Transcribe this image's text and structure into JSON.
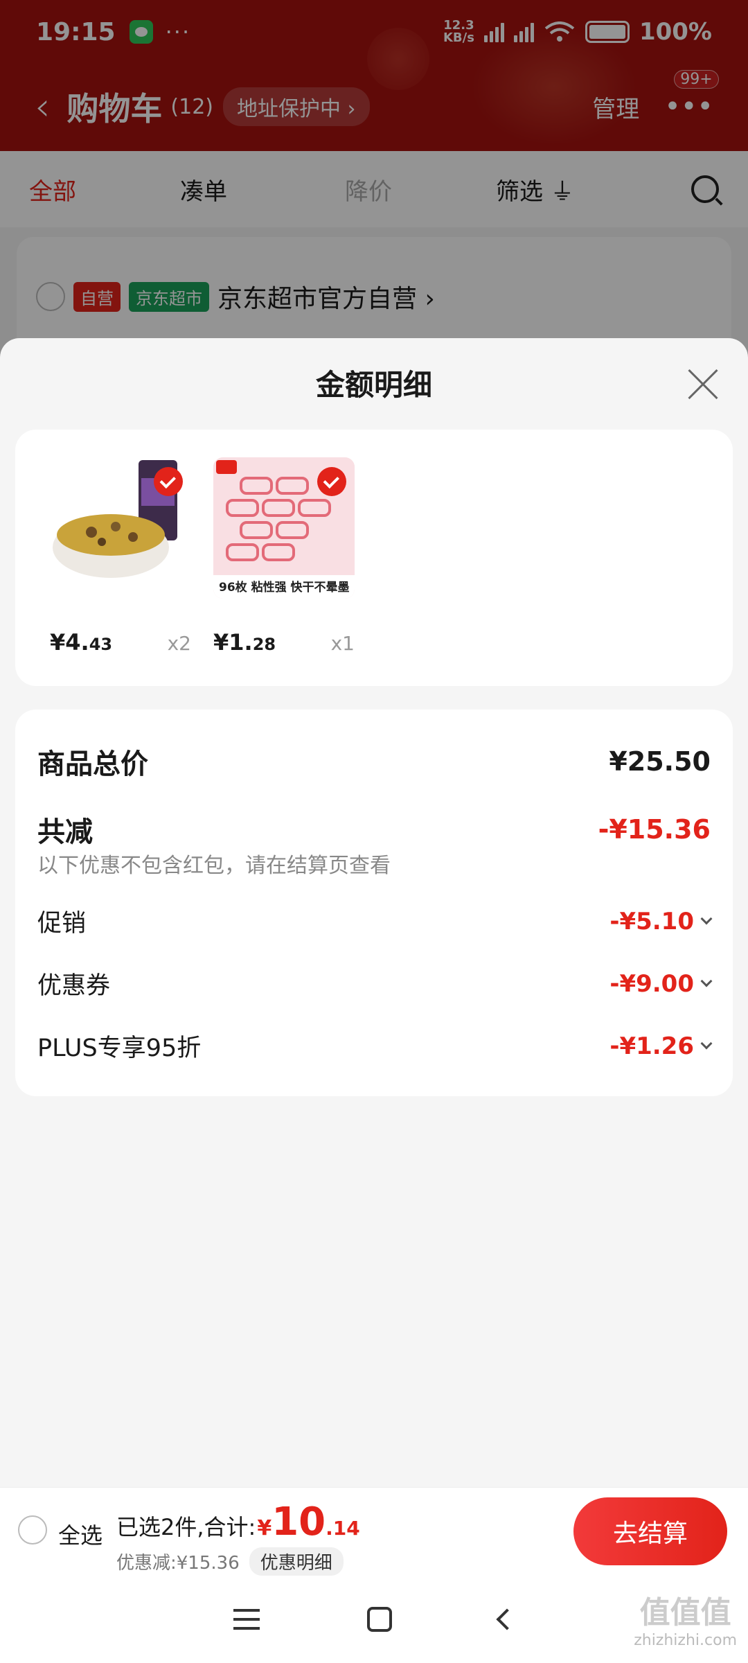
{
  "status_bar": {
    "time": "19:15",
    "net_speed_top": "12.3",
    "net_speed_bottom": "KB/s",
    "battery": "100%"
  },
  "header": {
    "title": "购物车",
    "count": "(12)",
    "address_badge": "地址保护中 ›",
    "manage": "管理",
    "more_badge": "99+"
  },
  "tabs": [
    {
      "label": "全部"
    },
    {
      "label": "凑单"
    },
    {
      "label": "降价"
    },
    {
      "label": "筛选"
    }
  ],
  "store": {
    "tag1": "自营",
    "tag2": "京东超市",
    "name": "京东超市官方自营 ›"
  },
  "sheet": {
    "title": "金额明细",
    "products": [
      {
        "price_int": "¥4.",
        "price_dec": "43",
        "qty": "x2"
      },
      {
        "price_int": "¥1.",
        "price_dec": "28",
        "qty": "x1",
        "img_text": "96枚  粘性强 快干不晕墨"
      }
    ],
    "summary": {
      "total_label": "商品总价",
      "total_value": "¥25.50",
      "discount_label": "共减",
      "discount_value": "-¥15.36",
      "note": "以下优惠不包含红包，请在结算页查看",
      "items": [
        {
          "label": "促销",
          "value": "-¥5.10"
        },
        {
          "label": "优惠券",
          "value": "-¥9.00"
        },
        {
          "label": "PLUS专享95折",
          "value": "-¥1.26"
        }
      ]
    }
  },
  "bottom_bar": {
    "select_all": "全选",
    "selected_text": "已选2件,合计:",
    "yen": "¥",
    "total_int": "10",
    "total_dec": ".14",
    "saved": "优惠减:¥15.36",
    "detail_link": "优惠明细",
    "checkout": "去结算"
  },
  "watermark": {
    "big": "值值值",
    "small": "zhizhizhi.com"
  }
}
